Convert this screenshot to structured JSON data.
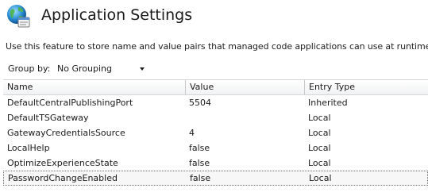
{
  "header": {
    "title": "Application Settings",
    "icon": "globe-settings-icon"
  },
  "description": "Use this feature to store name and value pairs that managed code applications can use at runtime.",
  "group_by": {
    "label": "Group by:",
    "selected": "No Grouping"
  },
  "table": {
    "columns": [
      "Name",
      "Value",
      "Entry Type"
    ],
    "rows": [
      {
        "name": "DefaultCentralPublishingPort",
        "value": "5504",
        "entry_type": "Inherited"
      },
      {
        "name": "DefaultTSGateway",
        "value": "",
        "entry_type": "Local"
      },
      {
        "name": "GatewayCredentialsSource",
        "value": "4",
        "entry_type": "Local"
      },
      {
        "name": "LocalHelp",
        "value": "false",
        "entry_type": "Local"
      },
      {
        "name": "OptimizeExperienceState",
        "value": "false",
        "entry_type": "Local"
      },
      {
        "name": "PasswordChangeEnabled",
        "value": "false",
        "entry_type": "Local"
      }
    ],
    "selected_row": 5
  }
}
